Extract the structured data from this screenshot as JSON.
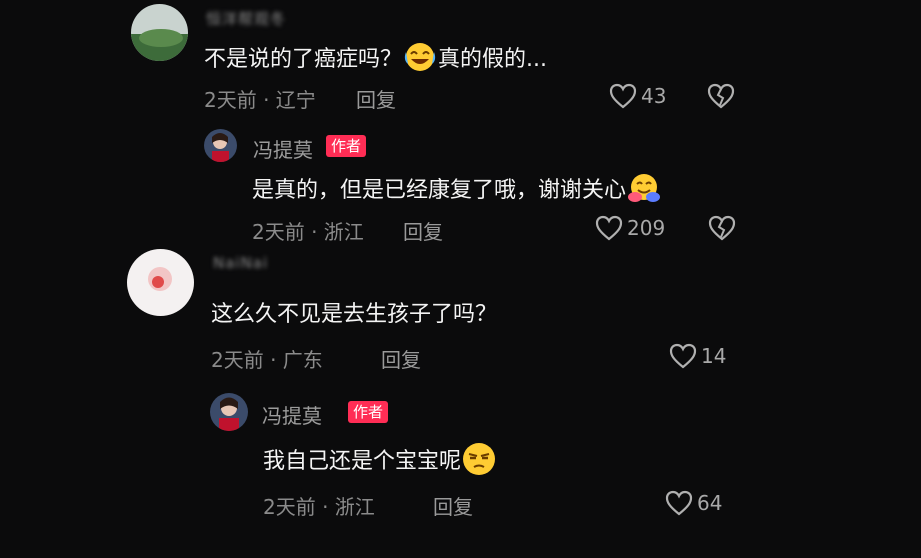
{
  "comments": [
    {
      "username": "恒洋帮观冬",
      "text": "不是说的了癌症吗？",
      "text_tail": "真的假的...",
      "emoji": "face-with-tears-of-joy",
      "meta": "2天前 · 辽宁",
      "reply_label": "回复",
      "likes": "43",
      "reply": {
        "name": "冯提莫",
        "badge": "作者",
        "text": "是真的，但是已经康复了哦，谢谢关心",
        "emoji": "hugging-face",
        "meta": "2天前 · 浙江",
        "reply_label": "回复",
        "likes": "209"
      }
    },
    {
      "username": "NaiNai",
      "text": "这么久不见是去生孩子了吗？",
      "meta": "2天前 · 广东",
      "reply_label": "回复",
      "likes": "14",
      "reply": {
        "name": "冯提莫",
        "badge": "作者",
        "text": "我自己还是个宝宝呢",
        "emoji": "unamused-face",
        "meta": "2天前 · 浙江",
        "reply_label": "回复",
        "likes": "64"
      }
    }
  ],
  "colors": {
    "background": "#0b0b0c",
    "badge": "#ff2d55",
    "text": "#f4f4f4",
    "muted": "#8b8b8b"
  }
}
